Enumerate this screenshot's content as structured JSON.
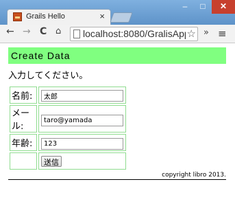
{
  "browser": {
    "tab_title": "Grails Hello",
    "tab_close": "×",
    "url": "localhost:8080/GralisApp",
    "window_controls": {
      "minimize": "–",
      "maximize": "□",
      "close": "✕"
    },
    "icons": {
      "back": "back-icon",
      "forward": "forward-icon",
      "reload": "reload-icon",
      "home": "home-icon",
      "star": "star-icon",
      "menu": "menu-icon"
    }
  },
  "page": {
    "heading": "Create Data",
    "intro": "入力してください。",
    "fields": [
      {
        "label": "名前:",
        "value": "太郎"
      },
      {
        "label": "メール:",
        "value": "taro@yamada"
      },
      {
        "label": "年齢:",
        "value": "123"
      }
    ],
    "submit_label": "送信",
    "copyright": "copyright libro 2013.",
    "colors": {
      "heading_bg": "#80ff80",
      "table_border": "#8fdc8f"
    }
  }
}
